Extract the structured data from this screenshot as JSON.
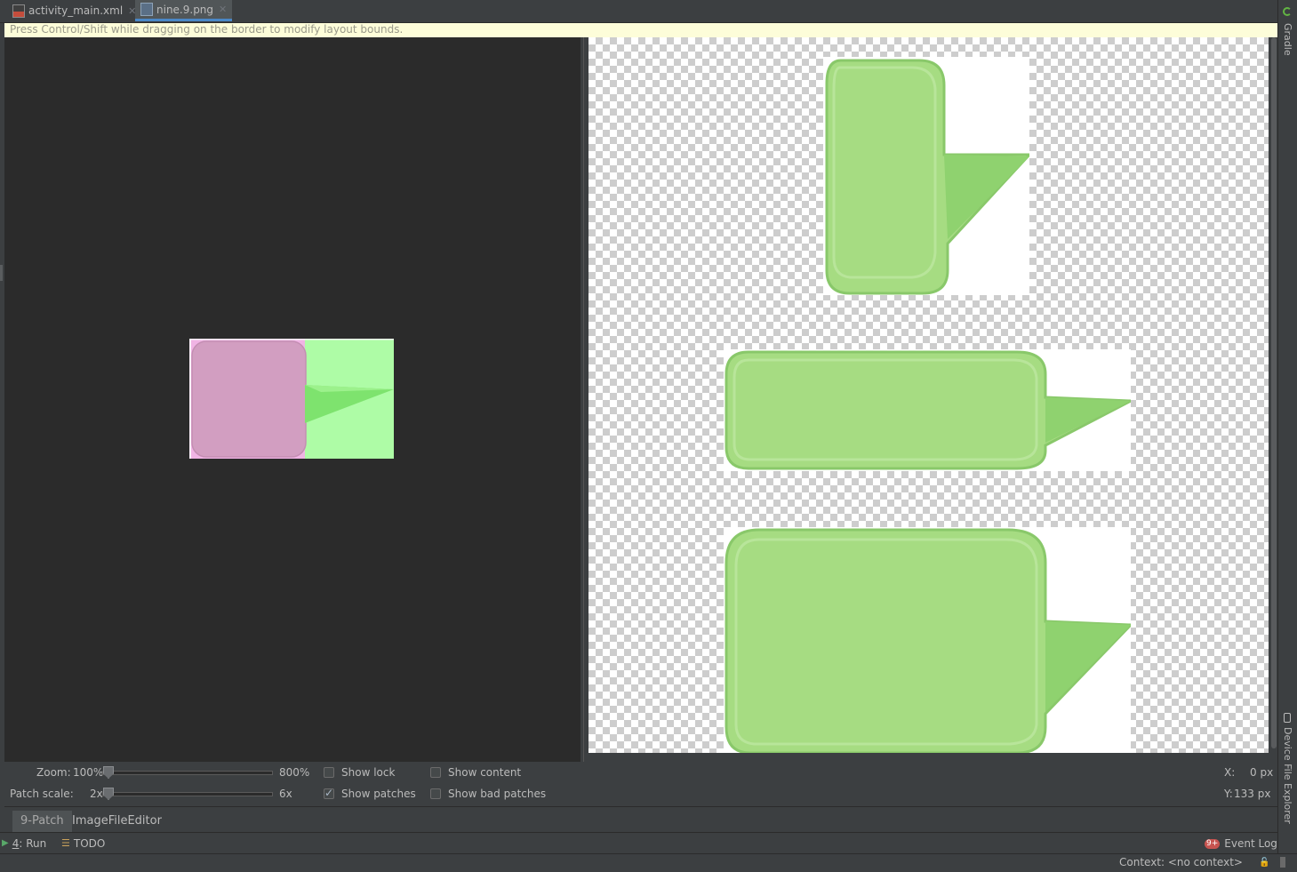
{
  "tabs": [
    {
      "label": "activity_main.xml",
      "icon": "xml-file-icon",
      "active": false
    },
    {
      "label": "nine.9.png",
      "icon": "png-file-icon",
      "active": true
    }
  ],
  "hint": "Press Control/Shift while dragging on the border to modify layout bounds.",
  "side_tools": {
    "gradle": "Gradle",
    "device_file_explorer": "Device File Explorer"
  },
  "controls": {
    "zoom": {
      "label": "Zoom:",
      "value": "100%",
      "max": "800%",
      "level": 0.0
    },
    "patch_scale": {
      "label": "Patch scale:",
      "value": "2x",
      "max": "6x",
      "level": 0.0
    },
    "show_lock": {
      "label": "Show lock",
      "checked": false
    },
    "show_content": {
      "label": "Show content",
      "checked": false
    },
    "show_patches": {
      "label": "Show patches",
      "checked": true
    },
    "show_bad_patches": {
      "label": "Show bad patches",
      "checked": false
    },
    "coord_x_label": "X:",
    "coord_x_value": "0 px",
    "coord_y_label": "Y:",
    "coord_y_value": "133 px"
  },
  "editor_tabs": [
    {
      "label": "9-Patch",
      "active": true
    },
    {
      "label": "ImageFileEditor",
      "active": false
    }
  ],
  "tool_windows": {
    "run_number": "4",
    "run_text": ": Run",
    "todo": "TODO",
    "event_log": "Event Log",
    "event_log_badge": "9+"
  },
  "status": {
    "context": "Context: <no context>"
  },
  "colors": {
    "bubble_green": "#a6dc82",
    "patch_pink": "#d29ec1",
    "patch_green": "#aefca6",
    "accent_blue": "#4a88c7"
  }
}
